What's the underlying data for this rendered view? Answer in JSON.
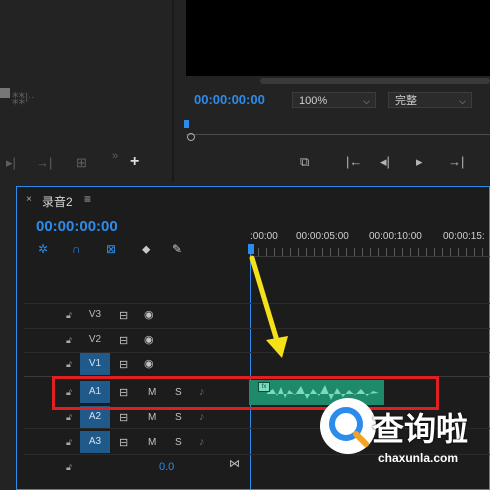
{
  "program_monitor": {
    "timecode": "00:00:00:00",
    "zoom_select": "100%",
    "quality_select": "完整"
  },
  "timeline": {
    "tab_close": "×",
    "tab_label": "录音2",
    "tab_menu": "≡",
    "timecode": "00:00:00:00",
    "ruler_labels": [
      ":00:00",
      "00:00:05:00",
      "00:00:10:00",
      "00:00:15:"
    ],
    "video_tracks": [
      "V3",
      "V2",
      "V1"
    ],
    "audio_tracks": [
      "A1",
      "A2",
      "A3"
    ],
    "mute_label": "M",
    "solo_label": "S",
    "master_volume": "0.0"
  },
  "watermark": {
    "brand": "查询啦",
    "url": "chaxunla.com"
  },
  "colors": {
    "accent": "#2d8ceb",
    "clip": "#1e8a6a",
    "highlight": "#e02020",
    "arrow": "#f5e11a"
  }
}
